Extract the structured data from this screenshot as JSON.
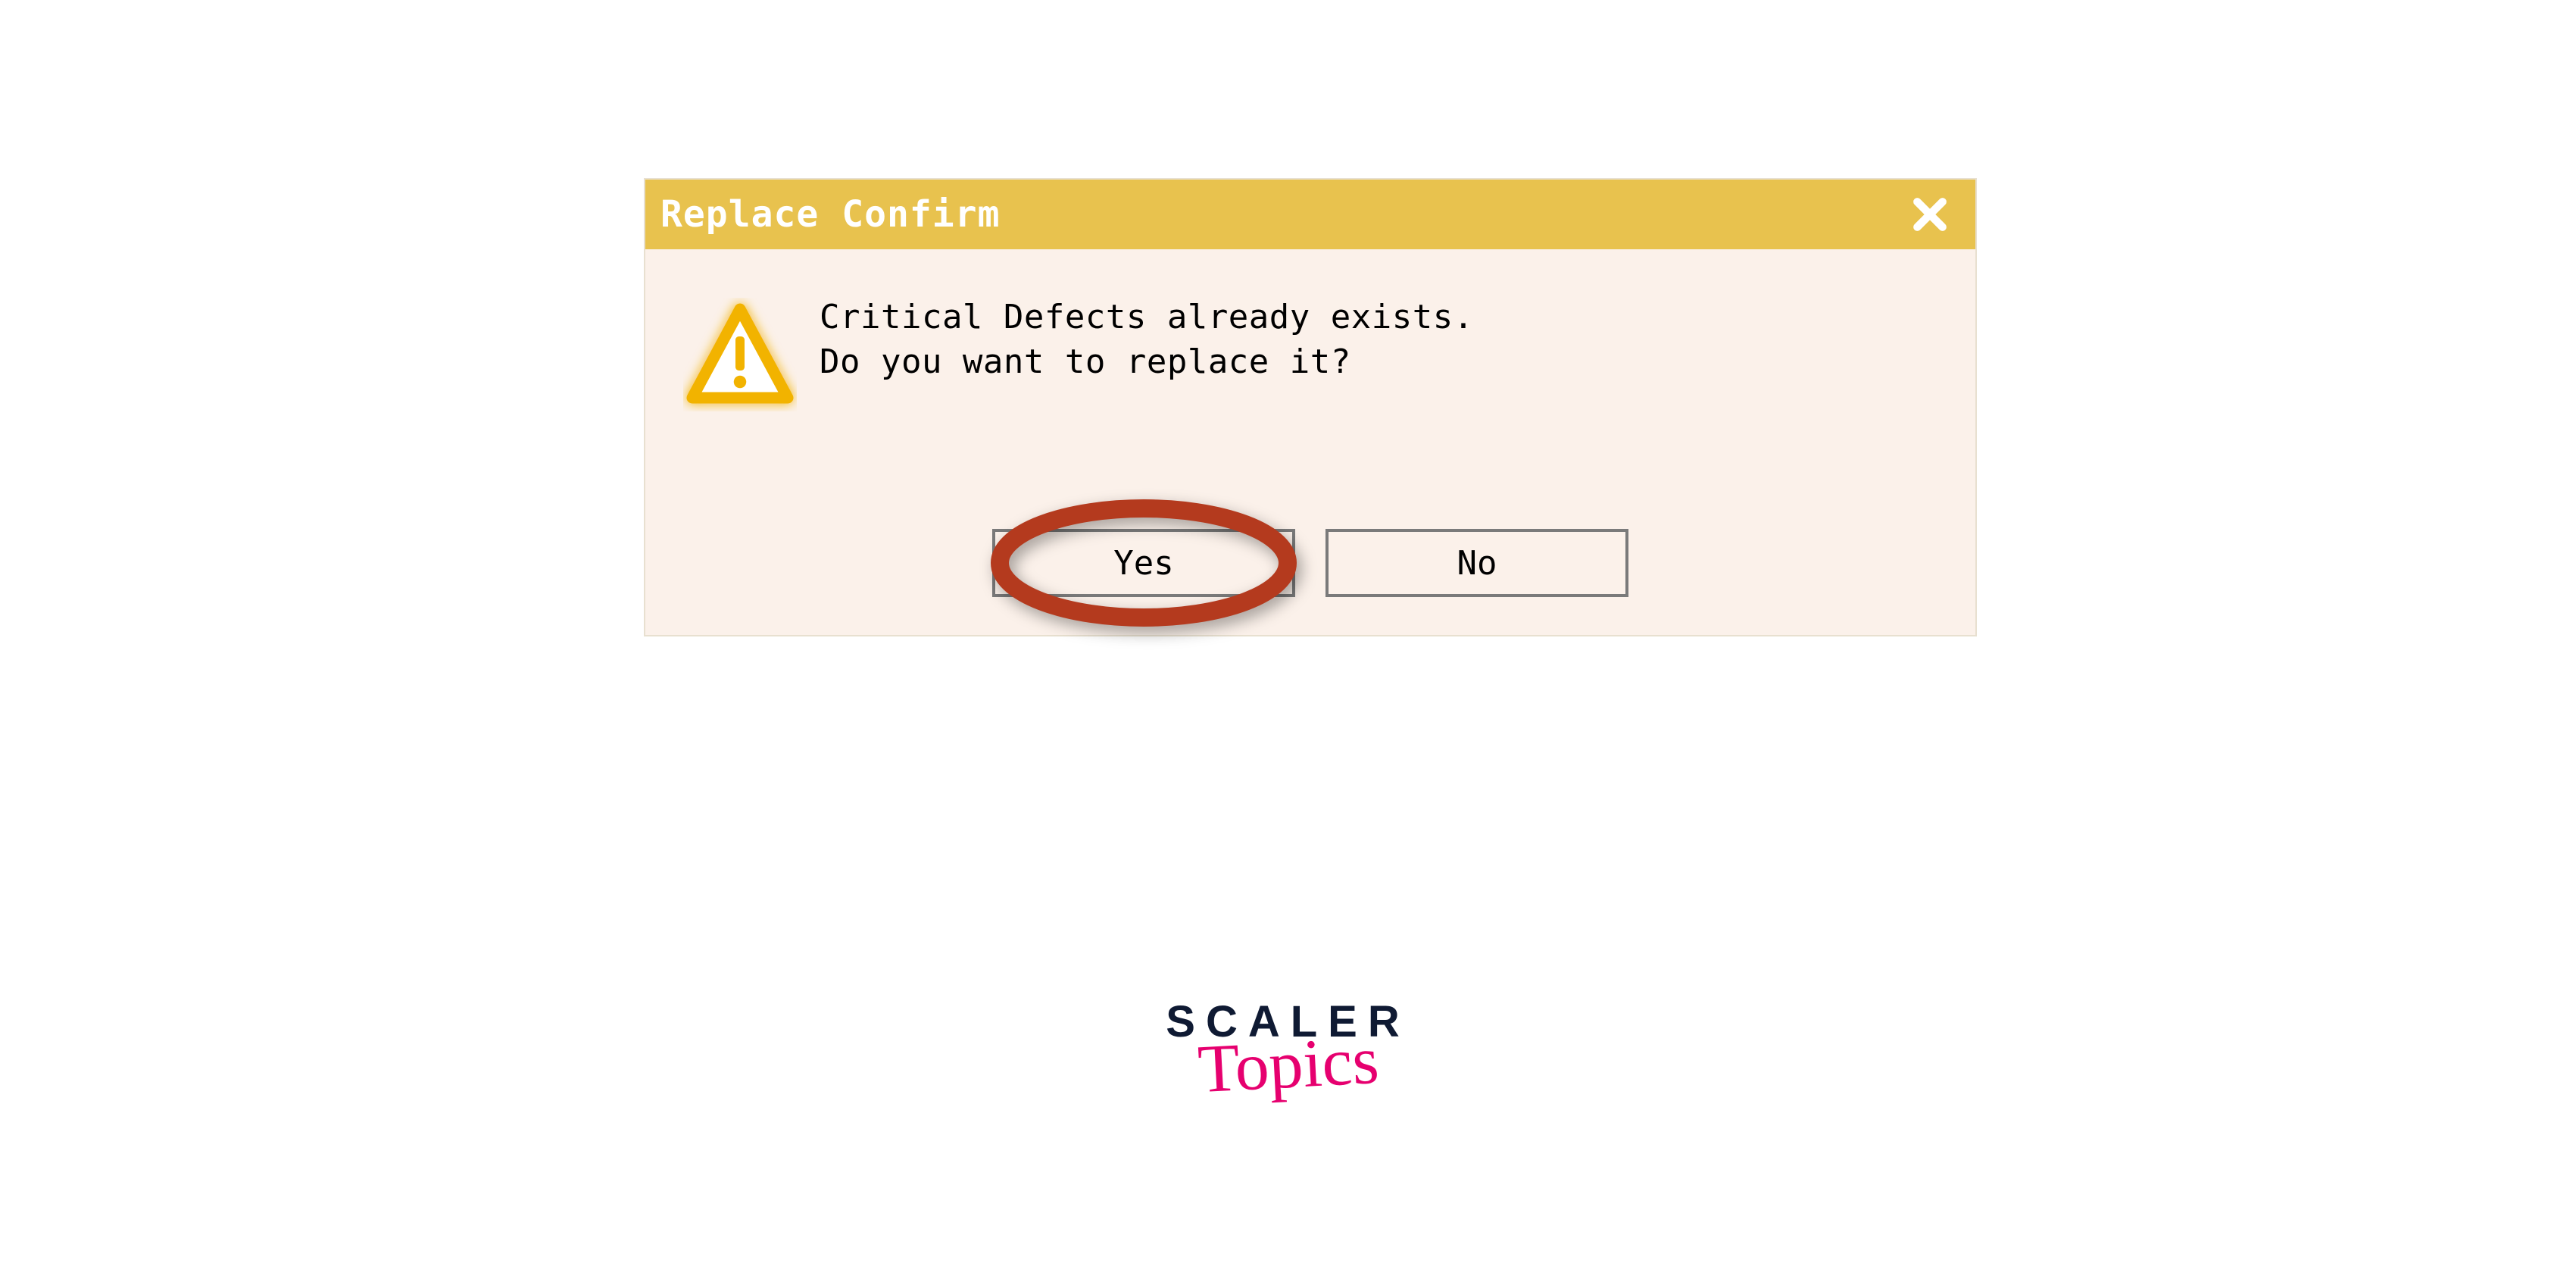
{
  "dialog": {
    "title": "Replace Confirm",
    "close_icon": "close-icon",
    "warning_icon": "warning-icon",
    "message_line1": "Critical Defects already exists.",
    "message_line2": "Do you want to replace it?",
    "buttons": {
      "yes_label": "Yes",
      "no_label": "No"
    },
    "annotation": {
      "highlighted_button": "yes",
      "color": "#b43a1e"
    }
  },
  "branding": {
    "line1": "SCALER",
    "line2": "Topics"
  },
  "colors": {
    "titlebar_bg": "#e8c24e",
    "dialog_bg": "#fbf1ea",
    "annotation_ring": "#b43a1e",
    "brand_dark": "#0f1a33",
    "brand_pink": "#e6006f"
  }
}
